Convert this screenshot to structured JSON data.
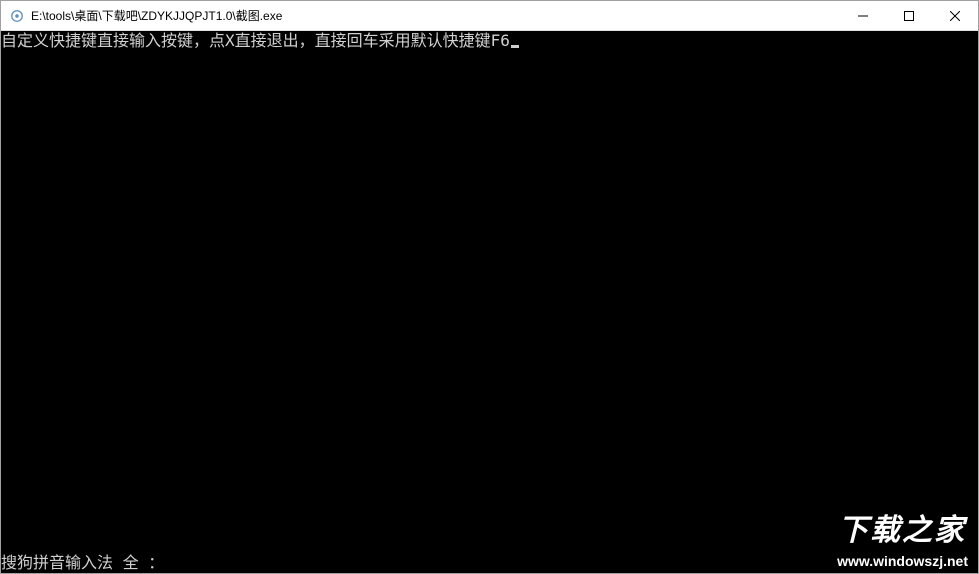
{
  "titlebar": {
    "title": "E:\\tools\\桌面\\下载吧\\ZDYKJJQPJT1.0\\截图.exe"
  },
  "console": {
    "prompt_line": "自定义快捷键直接输入按键，点X直接退出，直接回车采用默认快捷键F6",
    "ime_line": "搜狗拼音输入法 全 ："
  },
  "watermark": {
    "text_cn": "下载之家",
    "url": "www.windowszj.net"
  }
}
